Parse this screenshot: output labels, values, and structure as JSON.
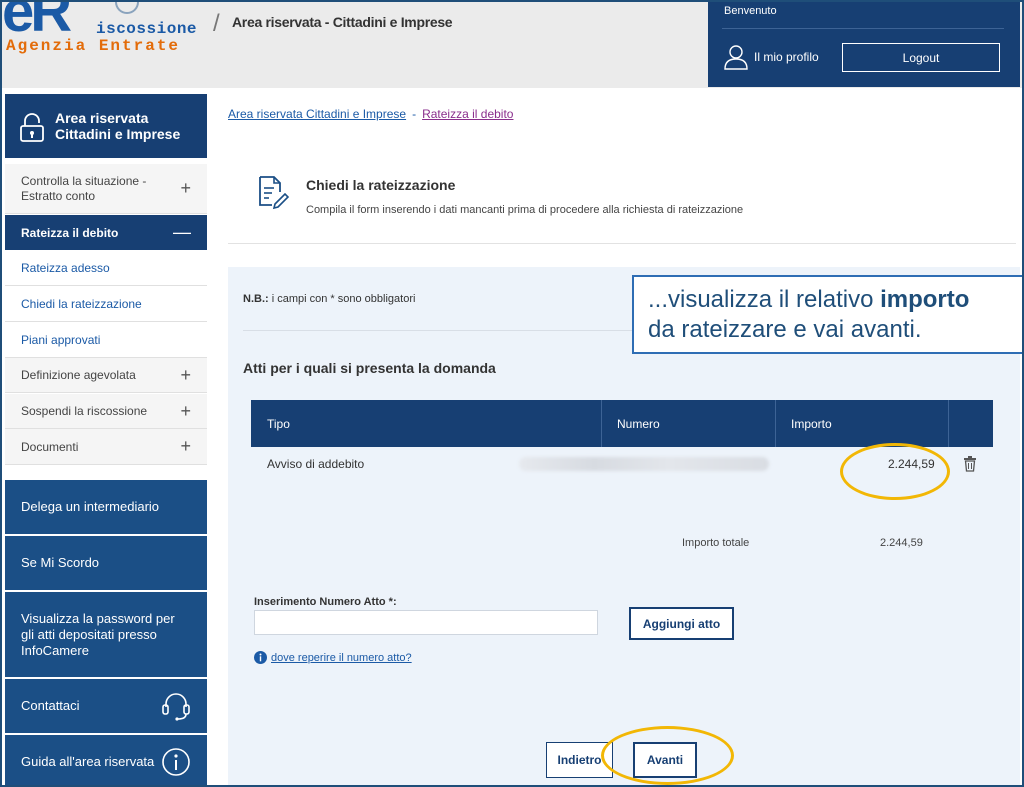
{
  "header": {
    "brand_mark": "eR",
    "brand_line1": "iscossione",
    "brand_line2": "Agenzia Entrate",
    "title": "Area riservata - Cittadini e Imprese",
    "welcome": "Benvenuto",
    "profile_label": "Il mio profilo",
    "logout_label": "Logout"
  },
  "sidebar": {
    "title_line1": "Area riservata",
    "title_line2": "Cittadini e Imprese",
    "items": [
      {
        "label_line1": "Controlla la situazione -",
        "label_line2": "Estratto conto",
        "toggle": "+"
      },
      {
        "label": "Rateizza il debito",
        "toggle": "—"
      },
      {
        "label": "Rateizza adesso"
      },
      {
        "label": "Chiedi la rateizzazione"
      },
      {
        "label": "Piani approvati"
      },
      {
        "label": "Definizione agevolata",
        "toggle": "+"
      },
      {
        "label": "Sospendi la riscossione",
        "toggle": "+"
      },
      {
        "label": "Documenti",
        "toggle": "+"
      }
    ],
    "links": [
      {
        "label": "Delega un intermediario"
      },
      {
        "label": "Se Mi Scordo"
      },
      {
        "label_line1": "Visualizza la password per",
        "label_line2": "gli atti depositati presso",
        "label_line3": "InfoCamere"
      },
      {
        "label": "Contattaci",
        "icon": "headset-icon"
      },
      {
        "label": "Guida all'area riservata",
        "icon": "info-icon"
      }
    ]
  },
  "breadcrumb": {
    "items": [
      "Area riservata Cittadini e Imprese",
      "Rateizza il debito"
    ],
    "separator": "-"
  },
  "page": {
    "title": "Chiedi la rateizzazione",
    "subtitle": "Compila il form inserendo i dati mancanti prima di procedere alla richiesta di rateizzazione",
    "note_prefix": "N.B.:",
    "note_text": " i campi con * sono obbligatori",
    "section_title": "Atti per i quali si presenta la domanda"
  },
  "table": {
    "columns": [
      "Tipo",
      "Numero",
      "Importo"
    ],
    "rows": [
      {
        "tipo": "Avviso di addebito",
        "numero": "",
        "importo": "2.244,59"
      }
    ],
    "total_label": "Importo totale",
    "total_value": "2.244,59"
  },
  "form": {
    "input_label": "Inserimento Numero Atto *:",
    "input_value": "",
    "add_button": "Aggiungi atto",
    "help_link": "dove reperire il numero atto?"
  },
  "actions": {
    "back": "Indietro",
    "next": "Avanti"
  },
  "annotation": {
    "text_part1": "...visualizza il relativo ",
    "text_bold": "importo",
    "text_part2": "da rateizzare e vai avanti."
  },
  "colors": {
    "navy": "#173f73",
    "sidebar_blue": "#1b4f86",
    "link": "#1b5aa6",
    "highlight": "#f2b705",
    "panel": "#edf3fa"
  }
}
